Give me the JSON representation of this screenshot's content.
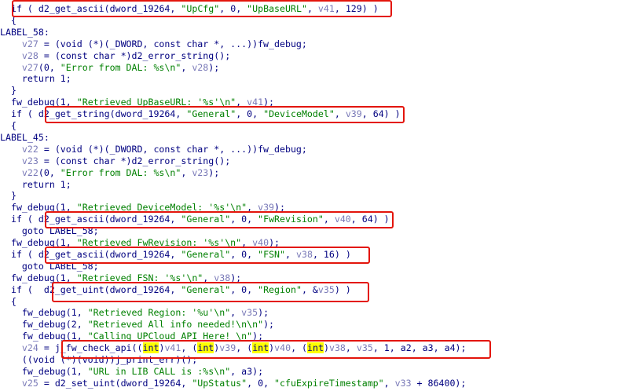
{
  "colors": {
    "keyword": "#000080",
    "variable": "#7a7ab8",
    "string": "#008000",
    "highlight": "#ffff00",
    "box": "#e3150c",
    "background": "#ffffff"
  },
  "lines": [
    {
      "segments": [
        {
          "t": "kw",
          "v": "  if ( "
        },
        {
          "t": "fn",
          "v": "d2_get_ascii"
        },
        {
          "t": "plain",
          "v": "(dword_19264, "
        },
        {
          "t": "str",
          "v": "\"UpCfg\""
        },
        {
          "t": "plain",
          "v": ", 0, "
        },
        {
          "t": "str",
          "v": "\"UpBaseURL\""
        },
        {
          "t": "plain",
          "v": ", "
        },
        {
          "t": "var",
          "v": "v41"
        },
        {
          "t": "plain",
          "v": ", 129) )"
        }
      ]
    },
    {
      "segments": [
        {
          "t": "plain",
          "v": "  {"
        }
      ]
    },
    {
      "segments": [
        {
          "t": "plain",
          "v": "LABEL_58:"
        }
      ]
    },
    {
      "segments": [
        {
          "t": "plain",
          "v": "    "
        },
        {
          "t": "var",
          "v": "v27"
        },
        {
          "t": "plain",
          "v": " = (void (*)(_DWORD, const char *, ...))fw_debug;"
        }
      ]
    },
    {
      "segments": [
        {
          "t": "plain",
          "v": "    "
        },
        {
          "t": "var",
          "v": "v28"
        },
        {
          "t": "plain",
          "v": " = (const char *)d2_error_string();"
        }
      ]
    },
    {
      "segments": [
        {
          "t": "plain",
          "v": "    "
        },
        {
          "t": "var",
          "v": "v27"
        },
        {
          "t": "plain",
          "v": "(0, "
        },
        {
          "t": "str",
          "v": "\"Error from DAL: %s\\n\""
        },
        {
          "t": "plain",
          "v": ", "
        },
        {
          "t": "var",
          "v": "v28"
        },
        {
          "t": "plain",
          "v": ");"
        }
      ]
    },
    {
      "segments": [
        {
          "t": "plain",
          "v": "    return 1;"
        }
      ]
    },
    {
      "segments": [
        {
          "t": "plain",
          "v": "  }"
        }
      ]
    },
    {
      "segments": [
        {
          "t": "plain",
          "v": "  fw_debug(1, "
        },
        {
          "t": "str",
          "v": "\"Retrieved UpBaseURL: '%s'\\n\""
        },
        {
          "t": "plain",
          "v": ", "
        },
        {
          "t": "var",
          "v": "v41"
        },
        {
          "t": "plain",
          "v": ");"
        }
      ]
    },
    {
      "segments": [
        {
          "t": "plain",
          "v": "  if ( "
        },
        {
          "t": "fn",
          "v": "d2_get_string"
        },
        {
          "t": "plain",
          "v": "(dword_19264, "
        },
        {
          "t": "str",
          "v": "\"General\""
        },
        {
          "t": "plain",
          "v": ", 0, "
        },
        {
          "t": "str",
          "v": "\"DeviceModel\""
        },
        {
          "t": "plain",
          "v": ", "
        },
        {
          "t": "var",
          "v": "v39"
        },
        {
          "t": "plain",
          "v": ", 64) )"
        }
      ]
    },
    {
      "segments": [
        {
          "t": "plain",
          "v": "  {"
        }
      ]
    },
    {
      "segments": [
        {
          "t": "plain",
          "v": "LABEL_45:"
        }
      ]
    },
    {
      "segments": [
        {
          "t": "plain",
          "v": "    "
        },
        {
          "t": "var",
          "v": "v22"
        },
        {
          "t": "plain",
          "v": " = (void (*)(_DWORD, const char *, ...))fw_debug;"
        }
      ]
    },
    {
      "segments": [
        {
          "t": "plain",
          "v": "    "
        },
        {
          "t": "var",
          "v": "v23"
        },
        {
          "t": "plain",
          "v": " = (const char *)d2_error_string();"
        }
      ]
    },
    {
      "segments": [
        {
          "t": "plain",
          "v": "    "
        },
        {
          "t": "var",
          "v": "v22"
        },
        {
          "t": "plain",
          "v": "(0, "
        },
        {
          "t": "str",
          "v": "\"Error from DAL: %s\\n\""
        },
        {
          "t": "plain",
          "v": ", "
        },
        {
          "t": "var",
          "v": "v23"
        },
        {
          "t": "plain",
          "v": ");"
        }
      ]
    },
    {
      "segments": [
        {
          "t": "plain",
          "v": "    return 1;"
        }
      ]
    },
    {
      "segments": [
        {
          "t": "plain",
          "v": "  }"
        }
      ]
    },
    {
      "segments": [
        {
          "t": "plain",
          "v": "  fw_debug(1, "
        },
        {
          "t": "str",
          "v": "\"Retrieved DeviceModel: '%s'\\n\""
        },
        {
          "t": "plain",
          "v": ", "
        },
        {
          "t": "var",
          "v": "v39"
        },
        {
          "t": "plain",
          "v": ");"
        }
      ]
    },
    {
      "segments": [
        {
          "t": "plain",
          "v": "  if ( "
        },
        {
          "t": "fn",
          "v": "d2_get_ascii"
        },
        {
          "t": "plain",
          "v": "(dword_19264, "
        },
        {
          "t": "str",
          "v": "\"General\""
        },
        {
          "t": "plain",
          "v": ", 0, "
        },
        {
          "t": "str",
          "v": "\"FwRevision\""
        },
        {
          "t": "plain",
          "v": ", "
        },
        {
          "t": "var",
          "v": "v40"
        },
        {
          "t": "plain",
          "v": ", 64) )"
        }
      ]
    },
    {
      "segments": [
        {
          "t": "plain",
          "v": "    goto LABEL_58;"
        }
      ]
    },
    {
      "segments": [
        {
          "t": "plain",
          "v": "  fw_debug(1, "
        },
        {
          "t": "str",
          "v": "\"Retrieved FwRevision: '%s'\\n\""
        },
        {
          "t": "plain",
          "v": ", "
        },
        {
          "t": "var",
          "v": "v40"
        },
        {
          "t": "plain",
          "v": ");"
        }
      ]
    },
    {
      "segments": [
        {
          "t": "plain",
          "v": "  if ( "
        },
        {
          "t": "fn",
          "v": "d2_get_ascii"
        },
        {
          "t": "plain",
          "v": "(dword_19264, "
        },
        {
          "t": "str",
          "v": "\"General\""
        },
        {
          "t": "plain",
          "v": ", 0, "
        },
        {
          "t": "str",
          "v": "\"FSN\""
        },
        {
          "t": "plain",
          "v": ", "
        },
        {
          "t": "var",
          "v": "v38"
        },
        {
          "t": "plain",
          "v": ", 16) )"
        }
      ]
    },
    {
      "segments": [
        {
          "t": "plain",
          "v": "    goto LABEL_58;"
        }
      ]
    },
    {
      "segments": [
        {
          "t": "plain",
          "v": "  fw_debug(1, "
        },
        {
          "t": "str",
          "v": "\"Retrieved FSN: '%s'\\n\""
        },
        {
          "t": "plain",
          "v": ", "
        },
        {
          "t": "var",
          "v": "v38"
        },
        {
          "t": "plain",
          "v": ");"
        }
      ]
    },
    {
      "segments": [
        {
          "t": "plain",
          "v": "  if (  "
        },
        {
          "t": "fn",
          "v": "d2_get_uint"
        },
        {
          "t": "plain",
          "v": "(dword_19264, "
        },
        {
          "t": "str",
          "v": "\"General\""
        },
        {
          "t": "plain",
          "v": ", 0, "
        },
        {
          "t": "str",
          "v": "\"Region\""
        },
        {
          "t": "plain",
          "v": ", &"
        },
        {
          "t": "var",
          "v": "v35"
        },
        {
          "t": "plain",
          "v": ") )"
        }
      ]
    },
    {
      "segments": [
        {
          "t": "plain",
          "v": "  {"
        }
      ]
    },
    {
      "segments": [
        {
          "t": "plain",
          "v": "    fw_debug(1, "
        },
        {
          "t": "str",
          "v": "\"Retrieved Region: '%u'\\n\""
        },
        {
          "t": "plain",
          "v": ", "
        },
        {
          "t": "var",
          "v": "v35"
        },
        {
          "t": "plain",
          "v": ");"
        }
      ]
    },
    {
      "segments": [
        {
          "t": "plain",
          "v": "    fw_debug(2, "
        },
        {
          "t": "str",
          "v": "\"Retrieved All info needed!\\n\\n\""
        },
        {
          "t": "plain",
          "v": ");"
        }
      ]
    },
    {
      "segments": [
        {
          "t": "plain",
          "v": "    fw_debug(1, "
        },
        {
          "t": "str",
          "v": "\"Calling UPCloud API Here! \\n\""
        },
        {
          "t": "plain",
          "v": ");"
        }
      ]
    },
    {
      "segments": [
        {
          "t": "plain",
          "v": "    "
        },
        {
          "t": "var",
          "v": "v24"
        },
        {
          "t": "plain",
          "v": " = j_fw_check_api(("
        },
        {
          "t": "hl",
          "v": "int"
        },
        {
          "t": "plain",
          "v": ")"
        },
        {
          "t": "var",
          "v": "v41"
        },
        {
          "t": "plain",
          "v": ", ("
        },
        {
          "t": "hl",
          "v": "int"
        },
        {
          "t": "plain",
          "v": ")"
        },
        {
          "t": "var",
          "v": "v39"
        },
        {
          "t": "plain",
          "v": ", ("
        },
        {
          "t": "hl",
          "v": "int"
        },
        {
          "t": "plain",
          "v": ")"
        },
        {
          "t": "var",
          "v": "v40"
        },
        {
          "t": "plain",
          "v": ", ("
        },
        {
          "t": "hl",
          "v": "int"
        },
        {
          "t": "plain",
          "v": ")"
        },
        {
          "t": "var",
          "v": "v38"
        },
        {
          "t": "plain",
          "v": ", "
        },
        {
          "t": "var",
          "v": "v35"
        },
        {
          "t": "plain",
          "v": ", 1, a2, a3, a4);"
        }
      ]
    },
    {
      "segments": [
        {
          "t": "plain",
          "v": "    ((void (*)(void))j_print_err)();"
        }
      ]
    },
    {
      "segments": [
        {
          "t": "plain",
          "v": "    fw_debug(1, "
        },
        {
          "t": "str",
          "v": "\"URL in LIB CALL is :%s\\n\""
        },
        {
          "t": "plain",
          "v": ", a3);"
        }
      ]
    },
    {
      "segments": [
        {
          "t": "plain",
          "v": "    "
        },
        {
          "t": "var",
          "v": "v25"
        },
        {
          "t": "plain",
          "v": " = d2_set_uint(dword_19264, "
        },
        {
          "t": "str",
          "v": "\"UpStatus\""
        },
        {
          "t": "plain",
          "v": ", 0, "
        },
        {
          "t": "str",
          "v": "\"cfuExpireTimestamp\""
        },
        {
          "t": "plain",
          "v": ", "
        },
        {
          "t": "var",
          "v": "v33"
        },
        {
          "t": "plain",
          "v": " + 86400);"
        }
      ]
    }
  ],
  "highlight_boxes": [
    {
      "name": "box-upbaseurl",
      "line": 0
    },
    {
      "name": "box-devicemodel",
      "line": 9
    },
    {
      "name": "box-fwrevision",
      "line": 18
    },
    {
      "name": "box-fsn",
      "line": 21
    },
    {
      "name": "box-region",
      "line": 24
    },
    {
      "name": "box-check-api",
      "line": 29
    }
  ]
}
